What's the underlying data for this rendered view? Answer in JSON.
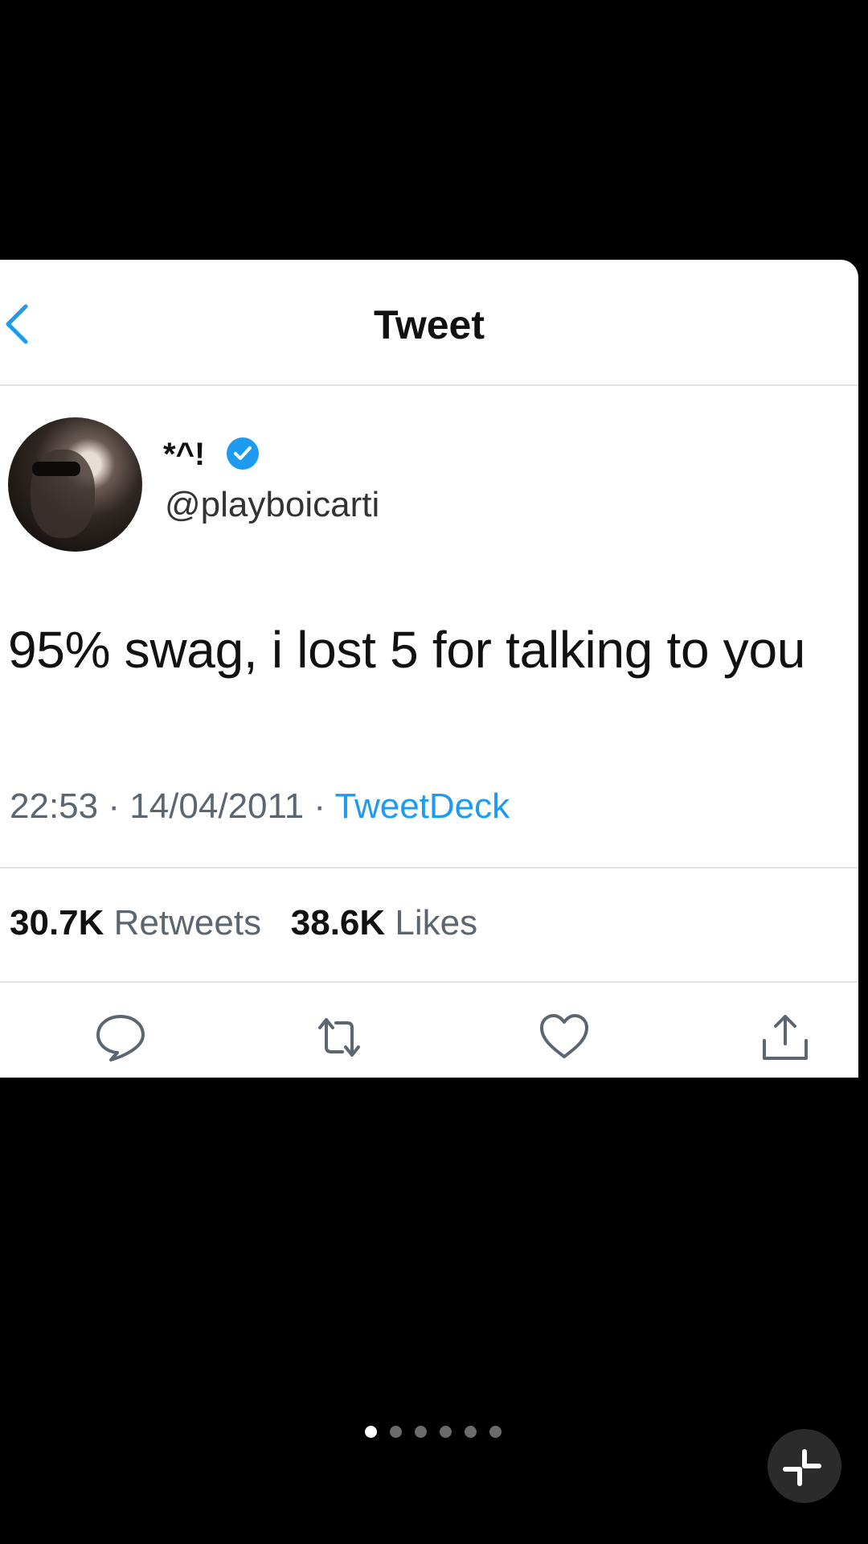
{
  "header": {
    "title": "Tweet",
    "back_icon": "chevron-left-icon"
  },
  "author": {
    "display_name": "*^!",
    "handle": "@playboicarti",
    "verified": true
  },
  "tweet": {
    "text": "95% swag, i lost 5 for talking to you"
  },
  "meta": {
    "time": "22:53",
    "date": "14/04/2011",
    "separator": "·",
    "source": "TweetDeck"
  },
  "stats": {
    "retweets_count": "30.7K",
    "retweets_label": "Retweets",
    "likes_count": "38.6K",
    "likes_label": "Likes"
  },
  "actions": [
    {
      "icon": "reply-icon"
    },
    {
      "icon": "retweet-icon"
    },
    {
      "icon": "like-icon"
    },
    {
      "icon": "share-icon"
    }
  ],
  "carousel": {
    "total": 6,
    "active": 1
  },
  "colors": {
    "accent": "#1d9bf0",
    "background": "#000000",
    "card": "#ffffff",
    "muted": "#5b6670"
  }
}
